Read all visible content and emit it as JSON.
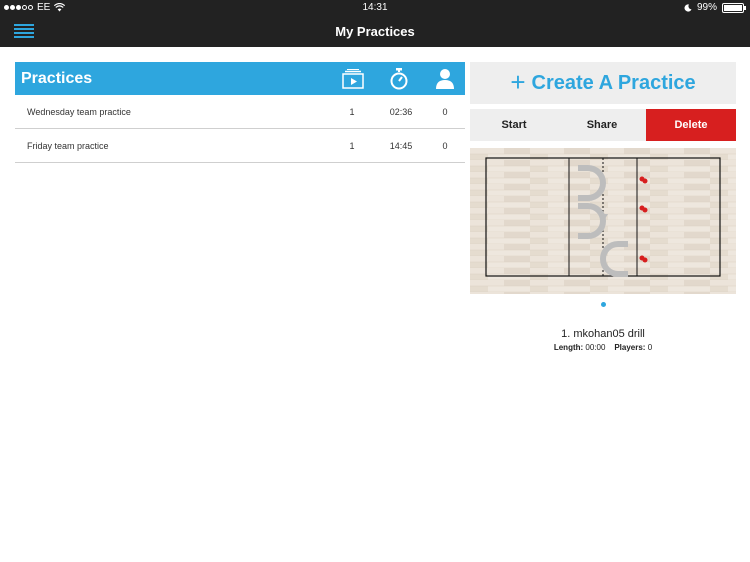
{
  "status_bar": {
    "carrier": "EE",
    "time": "14:31",
    "battery": "99%"
  },
  "nav": {
    "title": "My Practices",
    "menu_icon": "hamburger-menu-icon"
  },
  "practices": {
    "title": "Practices",
    "columns": [
      "drills-icon",
      "timer-icon",
      "player-icon"
    ],
    "rows": [
      {
        "name": "Wednesday team practice",
        "drills": "1",
        "length": "02:36",
        "players": "0"
      },
      {
        "name": "Friday team practice",
        "drills": "1",
        "length": "14:45",
        "players": "0"
      }
    ]
  },
  "create": {
    "label": "Create A Practice"
  },
  "actions": {
    "start": "Start",
    "share": "Share",
    "delete": "Delete"
  },
  "drill": {
    "name": "1. mkohan05 drill",
    "length_label": "Length:",
    "length_value": "00:00",
    "players_label": "Players:",
    "players_value": "0"
  },
  "colors": {
    "accent": "#2ea6de",
    "dark_bar": "#222222",
    "delete": "#d71f1f",
    "panel_bg": "#eeeeee"
  }
}
